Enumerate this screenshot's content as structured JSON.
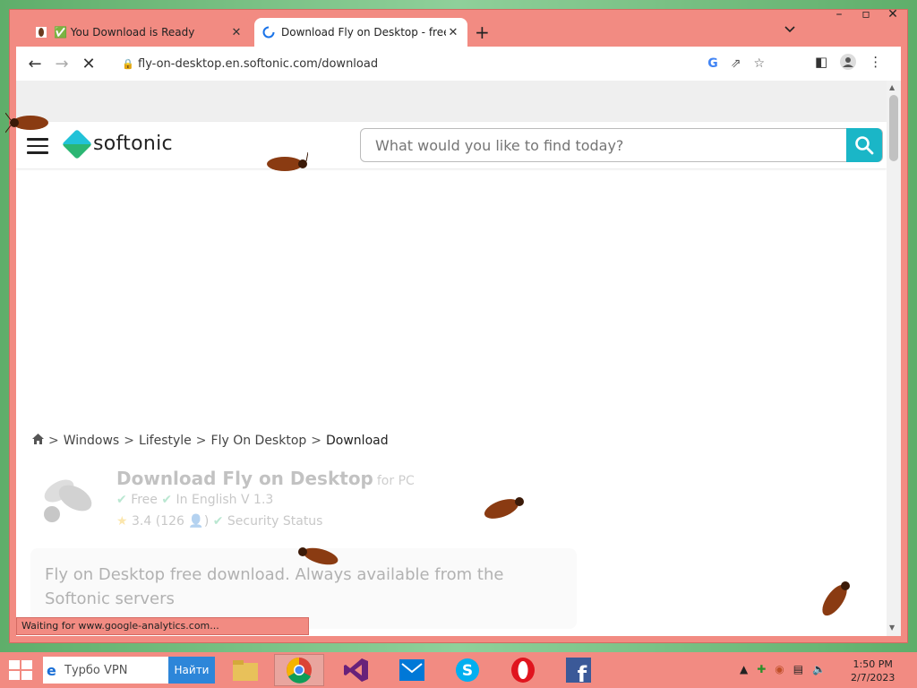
{
  "browser": {
    "tabs": [
      {
        "title": "✅ You Download is Ready",
        "active": false
      },
      {
        "title": "Download Fly on Desktop - free",
        "active": true
      }
    ],
    "new_tab_label": "+",
    "url": "fly-on-desktop.en.softonic.com/download",
    "status_text": "Waiting for www.google-analytics.com..."
  },
  "site": {
    "logo_text": "softonic",
    "search_placeholder": "What would you like to find today?",
    "breadcrumb": [
      "Windows",
      "Lifestyle",
      "Fly On Desktop",
      "Download"
    ],
    "app": {
      "title": "Download Fly on Desktop",
      "title_suffix": "for PC",
      "license": "Free",
      "language": "In English",
      "version": "V 1.3",
      "rating": "3.4",
      "rating_count": "(126",
      "rating_close": ")",
      "security": "Security Status"
    },
    "description": "Fly on Desktop free download. Always available from the Softonic servers"
  },
  "taskbar": {
    "search_text": "Турбо VPN",
    "find_button": "Найти",
    "time": "1:50 PM",
    "date": "2/7/2023"
  },
  "colors": {
    "frame": "#f28b82",
    "accent": "#1ab6c7",
    "desktop": "#7fc18a"
  }
}
